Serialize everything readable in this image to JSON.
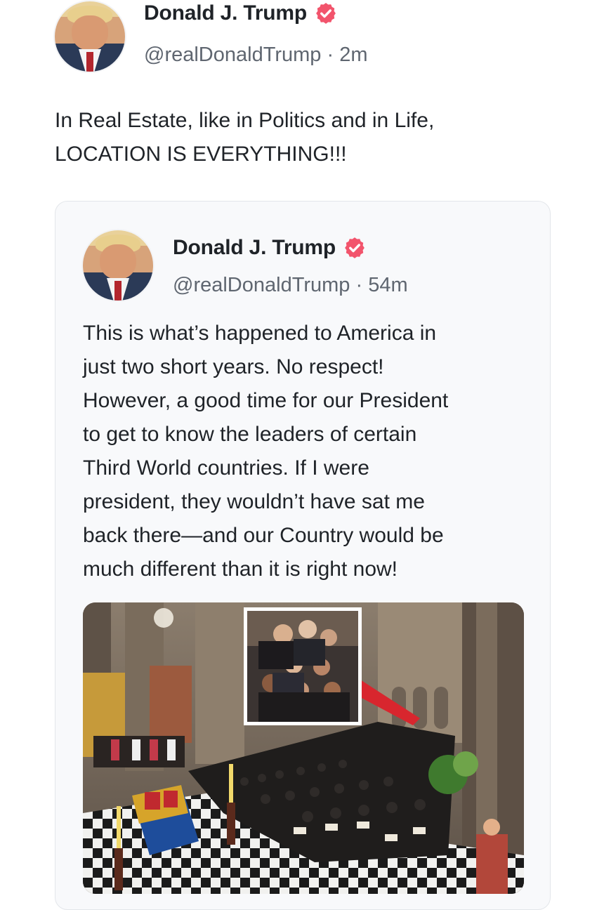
{
  "post": {
    "author_name": "Donald J. Trump",
    "handle": "@realDonaldTrump",
    "separator": "·",
    "time": "2m",
    "text_line1": "In Real Estate, like in Politics and in Life,",
    "text_line2": "LOCATION IS EVERYTHING!!!"
  },
  "quoted_post": {
    "author_name": "Donald J. Trump",
    "handle": "@realDonaldTrump",
    "separator": "·",
    "time": "54m",
    "text_lines": [
      "This is what’s happened to America in",
      "just two short years. No respect!",
      "However, a good time for our President",
      "to get to know the leaders of certain",
      "Third World countries. If I were",
      "president, they wouldn’t have sat me",
      "back there—and our Country would be",
      "much different than it is right now!"
    ]
  },
  "icons": {
    "verified": "verified-badge-icon"
  },
  "colors": {
    "verified_badge": "#f2546c",
    "name_text": "#1f2328",
    "secondary_text": "#5f6670",
    "card_border": "#e3e6ea"
  }
}
